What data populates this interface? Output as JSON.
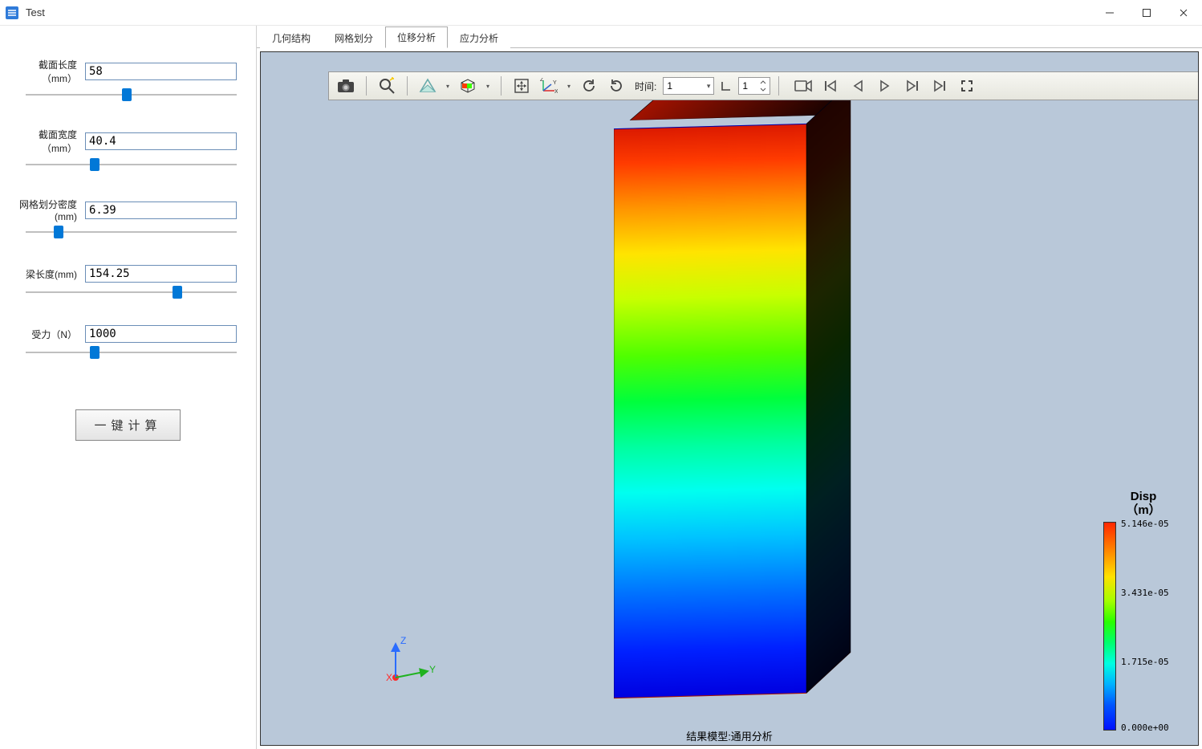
{
  "window": {
    "title": "Test",
    "min": "—",
    "max": "☐",
    "close": "✕"
  },
  "params": {
    "section_length": {
      "label": "截面长度（mm）",
      "value": "58",
      "slider_pct": 48
    },
    "section_width": {
      "label": "截面宽度（mm）",
      "value": "40.4",
      "slider_pct": 32
    },
    "mesh_density": {
      "label": "网格划分密度(mm)",
      "value": "6.39",
      "slider_pct": 14
    },
    "beam_length": {
      "label": "梁长度(mm)",
      "value": "154.25",
      "slider_pct": 73
    },
    "force": {
      "label": "受力（N）",
      "value": "1000",
      "slider_pct": 32
    }
  },
  "calc_button": "一键计算",
  "tabs": {
    "items": [
      "几何结构",
      "网格划分",
      "位移分析",
      "应力分析"
    ],
    "active_index": 2
  },
  "toolbar": {
    "time_label": "时间:",
    "time_combo_value": "1",
    "frame_value": "1"
  },
  "legend": {
    "title_line1": "Disp",
    "title_line2": "（m）",
    "max": "5.146e-05",
    "mid_high": "3.431e-05",
    "mid_low": "1.715e-05",
    "min": "0.000e+00"
  },
  "triad": {
    "x": "X",
    "y": "Y",
    "z": "Z"
  },
  "result_model_label": "结果模型:通用分析",
  "chart_data": {
    "type": "heatmap",
    "title": "Disp (m)",
    "quantity": "Displacement magnitude",
    "unit": "m",
    "colormap": "rainbow",
    "range": [
      0.0,
      5.146e-05
    ],
    "ticks": [
      {
        "value": 5.146e-05,
        "label": "5.146e-05"
      },
      {
        "value": 3.431e-05,
        "label": "3.431e-05"
      },
      {
        "value": 1.715e-05,
        "label": "1.715e-05"
      },
      {
        "value": 0.0,
        "label": "0.000e+00"
      }
    ],
    "geometry": "rectangular beam",
    "gradient_direction": "along beam length (Z axis)",
    "note": "Displacement increases roughly linearly from fixed base (0) to free top (5.146e-05 m)."
  }
}
